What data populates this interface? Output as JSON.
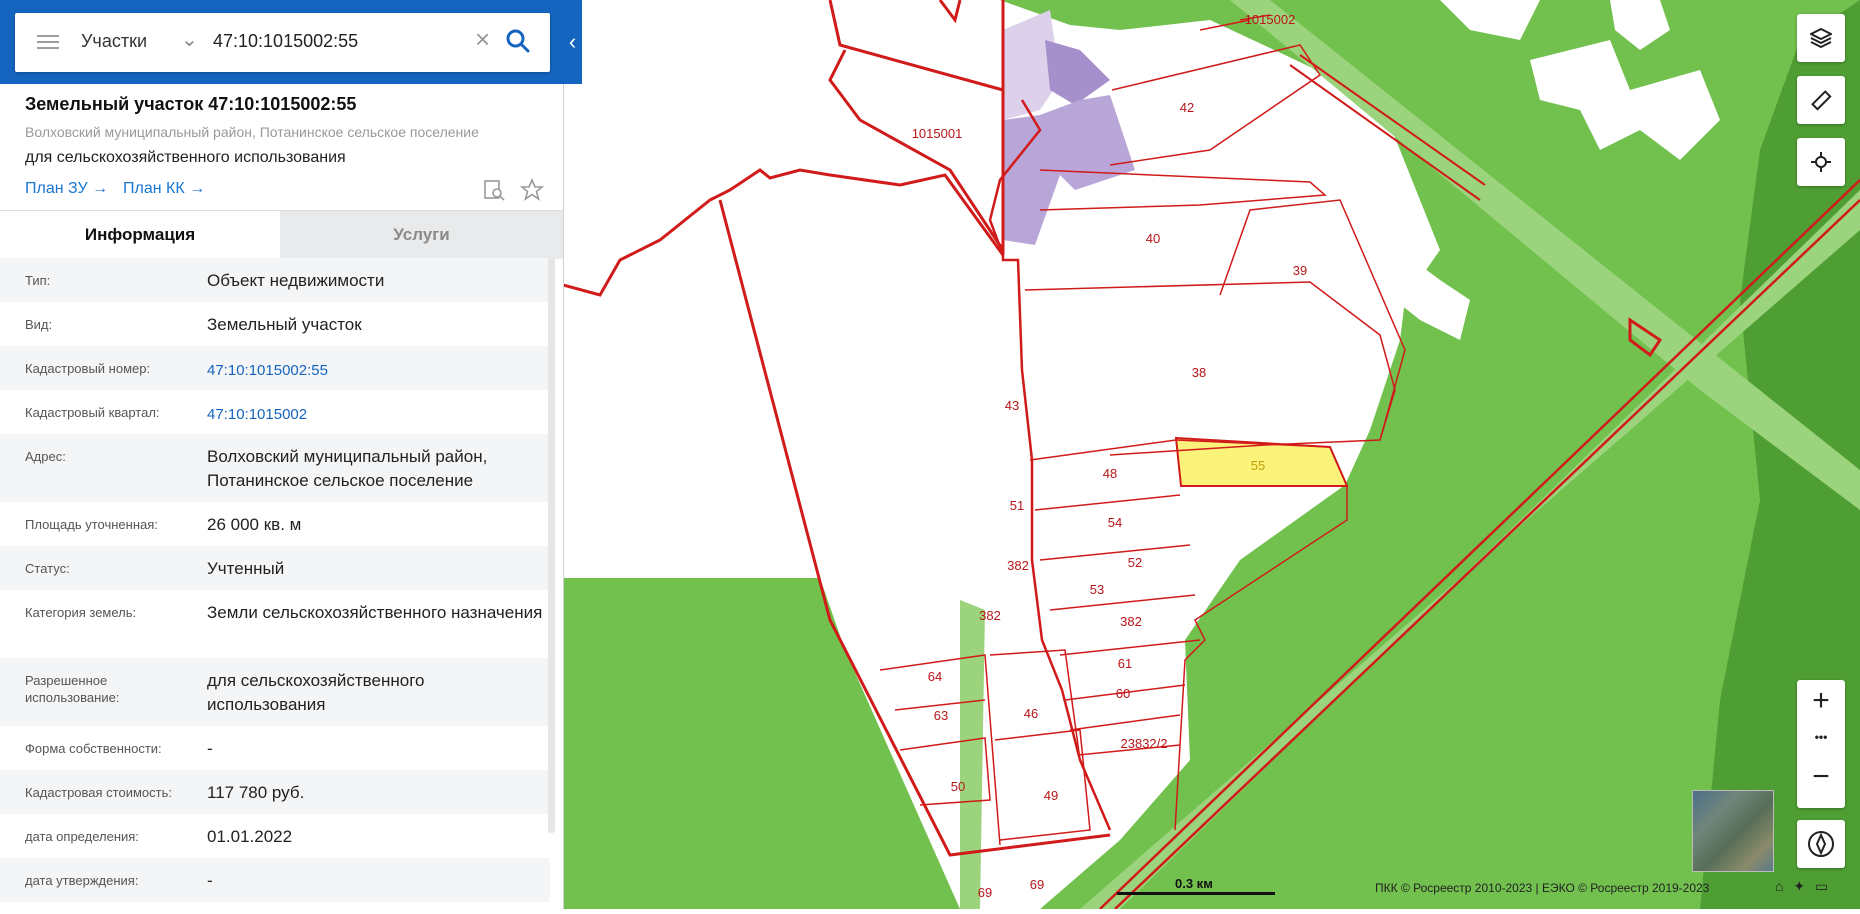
{
  "search": {
    "category": "Участки",
    "query": "47:10:1015002:55"
  },
  "object": {
    "title": "Земельный участок 47:10:1015002:55",
    "subtitle": "Волховский муниципальный район, Потанинское сельское поселение",
    "use": "для сельскохозяйственного использования",
    "plan_zu": "План ЗУ",
    "plan_kk": "План КК"
  },
  "tabs": {
    "info": "Информация",
    "services": "Услуги"
  },
  "rows": [
    {
      "label": "Тип:",
      "value": "Объект недвижимости"
    },
    {
      "label": "Вид:",
      "value": "Земельный участок"
    },
    {
      "label": "Кадастровый номер:",
      "value": "47:10:1015002:55"
    },
    {
      "label": "Кадастровый квартал:",
      "value": "47:10:1015002"
    },
    {
      "label": "Адрес:",
      "value": "Волховский муниципальный район, Потанинское сельское поселение"
    },
    {
      "label": "Площадь уточненная:",
      "value": "26 000 кв. м"
    },
    {
      "label": "Статус:",
      "value": "Учтенный"
    },
    {
      "label": "Категория земель:",
      "value": "Земли сельскохозяйственного назначения"
    },
    {
      "label": "Разрешенное использование:",
      "value": "для сельскохозяйственного использования"
    },
    {
      "label": "Форма собственности:",
      "value": "-"
    },
    {
      "label": "Кадастровая стоимость:",
      "value": "117 780 руб."
    },
    {
      "label": "дата определения:",
      "value": "01.01.2022"
    },
    {
      "label": "дата утверждения:",
      "value": "-"
    }
  ],
  "map": {
    "quarter_a": "1015001",
    "quarter_b": "1015002",
    "parcels": [
      "42",
      "40",
      "39",
      "38",
      "43",
      "48",
      "55",
      "54",
      "51",
      "52",
      "382",
      "53",
      "382",
      "382",
      "61",
      "60",
      "64",
      "63",
      "46",
      "23832/2",
      "50",
      "49",
      "69",
      "69"
    ],
    "scale": "0.3 км",
    "copyright": "ПКК © Росреестр 2010-2023 | ЕЭКО © Росреестр 2019-2023",
    "selected_color": "#fbf37a",
    "boundary_color": "#d11a1a",
    "forest_color": "#72c14e"
  },
  "zoom": {
    "plus": "+",
    "more": "•••",
    "minus": "−"
  }
}
